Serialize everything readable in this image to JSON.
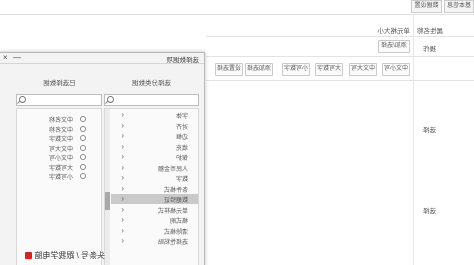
{
  "tabs": [
    "基本信息",
    "数据设置"
  ],
  "form": {
    "name_label": "属性名称",
    "name_value": "单元格大小",
    "action_label": "操作",
    "action_button": "添加/选择",
    "format_buttons": [
      "中文小写",
      "中文大写",
      "大写数字",
      "小写数字",
      "添加选择",
      "设置选择"
    ],
    "select_labels": [
      "选择",
      "选择"
    ]
  },
  "dialog": {
    "title": "选择数据项",
    "minimize": "—",
    "close": "×",
    "left_panel": {
      "header": "选择分类数据",
      "search_icon": "search-icon",
      "chevron_icon": "chevron-right-icon",
      "chevron_glyph": "‹",
      "selected_index": 8,
      "items": [
        "字体",
        "对齐",
        "边框",
        "填充",
        "保护",
        "人民币金额",
        "数字",
        "条件格式",
        "数据验证",
        "单元格样式",
        "格式刷",
        "清除格式",
        "选择性粘贴"
      ]
    },
    "right_panel": {
      "header": "已选择数据",
      "search_icon": "search-icon",
      "item_icon": "radio-icon",
      "items": [
        "中文名称",
        "中文名称",
        "中文数字",
        "中文大写",
        "中文小写",
        "大写数字",
        "小写数字"
      ]
    }
  },
  "watermark": {
    "text": "头条号 / 跟我学电脑"
  },
  "colors": {
    "selected_row": "#c9c9c9",
    "scroll_thumb": "#a9a9a9",
    "border": "#cccccc",
    "watermark_logo": "#e02020"
  }
}
